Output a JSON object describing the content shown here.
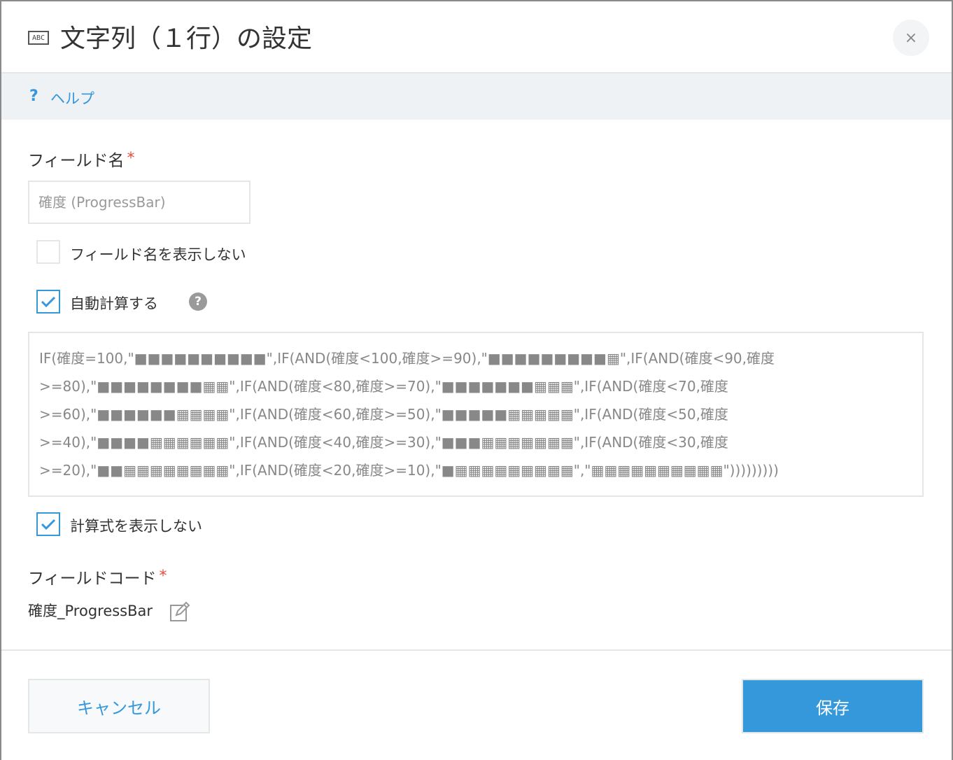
{
  "dialog": {
    "title": "文字列（１行）の設定",
    "title_icon": "abc-text-field-icon",
    "title_icon_text": "ABC",
    "close_symbol": "×"
  },
  "help": {
    "icon_glyph": "?",
    "label": "ヘルプ"
  },
  "field_name": {
    "label": "フィールド名",
    "required_mark": "*",
    "value": "確度 (ProgressBar)"
  },
  "options": {
    "hide_field_name": {
      "label": "フィールド名を表示しない",
      "checked": false
    },
    "auto_calculate": {
      "label": "自動計算する",
      "checked": true,
      "help_glyph": "?"
    },
    "hide_formula": {
      "label": "計算式を表示しない",
      "checked": true
    }
  },
  "formula": {
    "lines": [
      "IF(確度=100,\"■■■■■■■■■■\",IF(AND(確度<100,確度>=90),\"■■■■■■■■■▦\",IF(AND(確度<90,確度",
      ">=80),\"■■■■■■■■▦▦\",IF(AND(確度<80,確度>=70),\"■■■■■■■▦▦▦\",IF(AND(確度<70,確度",
      ">=60),\"■■■■■■▦▦▦▦\",IF(AND(確度<60,確度>=50),\"■■■■■▦▦▦▦▦\",IF(AND(確度<50,確度",
      ">=40),\"■■■■▦▦▦▦▦▦\",IF(AND(確度<40,確度>=30),\"■■■▦▦▦▦▦▦▦\",IF(AND(確度<30,確度",
      ">=20),\"■■▦▦▦▦▦▦▦▦\",IF(AND(確度<20,確度>=10),\"■▦▦▦▦▦▦▦▦▦\",\"▦▦▦▦▦▦▦▦▦▦\")))))))))"
    ]
  },
  "field_code": {
    "label": "フィールドコード",
    "required_mark": "*",
    "value": "確度_ProgressBar",
    "edit_icon": "edit-pencil-icon"
  },
  "footer": {
    "cancel_label": "キャンセル",
    "save_label": "保存"
  },
  "colors": {
    "accent": "#3498db",
    "required": "#e74c3c",
    "help_bar_bg": "#eef2f5",
    "border": "#e3e7e8"
  }
}
